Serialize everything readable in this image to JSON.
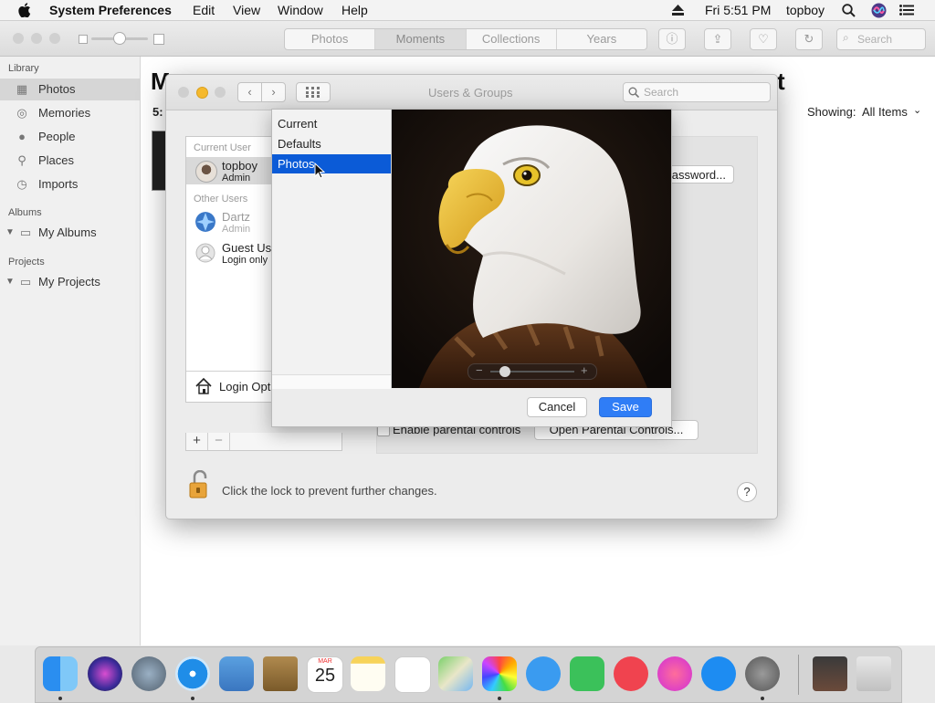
{
  "menubar": {
    "app_name": "System Preferences",
    "menus": [
      "Edit",
      "View",
      "Window",
      "Help"
    ],
    "clock": "Fri 5:51 PM",
    "user": "topboy"
  },
  "photos": {
    "tabs": [
      "Photos",
      "Moments",
      "Collections",
      "Years"
    ],
    "selected_tab": "Moments",
    "search_placeholder": "Search",
    "title_fragment": "M",
    "title_fragment_tail": "t",
    "subtitle_fragment": "5:",
    "showing_label": "Showing:",
    "showing_value": "All Items",
    "sidebar": {
      "library_header": "Library",
      "library_items": [
        "Photos",
        "Memories",
        "People",
        "Places",
        "Imports"
      ],
      "albums_header": "Albums",
      "albums_item": "My Albums",
      "projects_header": "Projects",
      "projects_item": "My Projects"
    }
  },
  "users_groups": {
    "title": "Users & Groups",
    "search_placeholder": "Search",
    "current_user_header": "Current User",
    "current_user": {
      "name": "topboy",
      "role": "Admin"
    },
    "other_users_header": "Other Users",
    "other_users": [
      {
        "name": "Dartz",
        "role": "Admin"
      },
      {
        "name": "Guest Us",
        "role": "Login only"
      }
    ],
    "login_options": "Login Opt",
    "add_symbol": "+",
    "remove_symbol": "−",
    "password_button": "assword...",
    "enable_parental": "Enable parental controls",
    "open_parental": "Open Parental Controls...",
    "lock_text": "Click the lock to prevent further changes.",
    "help_symbol": "?"
  },
  "picture_popup": {
    "sources": [
      "Current",
      "Defaults",
      "Photos"
    ],
    "selected_source": "Photos",
    "zoom_minus": "−",
    "zoom_plus": "+",
    "zoom_level": 0.12,
    "cancel_label": "Cancel",
    "save_label": "Save"
  },
  "dock": {
    "calendar_month": "MAR",
    "calendar_day": "25"
  },
  "colors": {
    "selection_blue": "#0b5bd7",
    "save_button": "#2f7df6",
    "traffic_yellow": "#f5b92d"
  }
}
